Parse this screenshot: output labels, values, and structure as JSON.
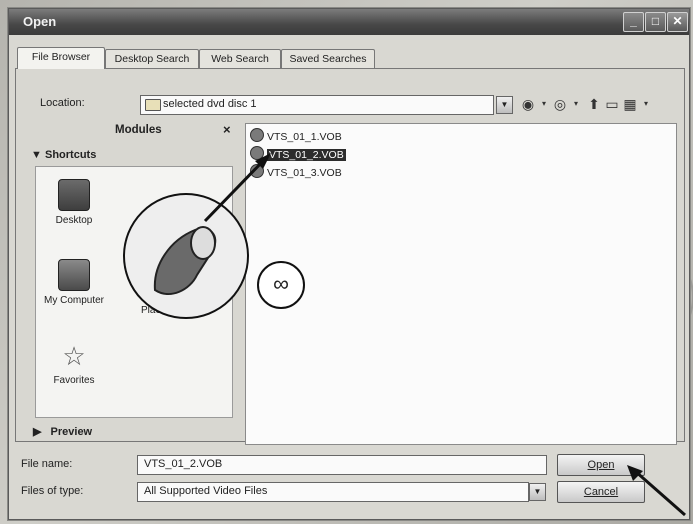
{
  "window": {
    "title": "Open"
  },
  "tabs": [
    {
      "label": "File Browser"
    },
    {
      "label": "Desktop Search"
    },
    {
      "label": "Web Search"
    },
    {
      "label": "Saved Searches"
    }
  ],
  "location": {
    "label": "Location:",
    "value": "selected dvd disc 1"
  },
  "modules": {
    "title": "Modules",
    "close_glyph": "×",
    "shortcuts_label": "Shortcuts",
    "preview_label": "Preview",
    "shortcuts": [
      {
        "label": "Desktop",
        "icon": "desktop-icon"
      },
      {
        "label": "My Computer",
        "icon": "computer-icon"
      },
      {
        "label": "Places",
        "icon": "places-icon"
      },
      {
        "label": "Favorites",
        "icon": "star-icon"
      }
    ]
  },
  "files": [
    {
      "name": "VTS_01_1.VOB"
    },
    {
      "name": "VTS_01_2.VOB",
      "selected": true
    },
    {
      "name": "VTS_01_3.VOB"
    }
  ],
  "callouts": {
    "mouse_glyph": "∞",
    "mouse_glyph_detail": "ᲈ"
  },
  "filename": {
    "label": "File name:",
    "value": "VTS_01_2.VOB"
  },
  "filetype": {
    "label": "Files of type:",
    "value": "All Supported Video Files"
  },
  "buttons": {
    "open": "Open",
    "cancel": "Cancel"
  },
  "colors": {
    "selection": "#2c2c2c",
    "titlebar": "#474747"
  }
}
